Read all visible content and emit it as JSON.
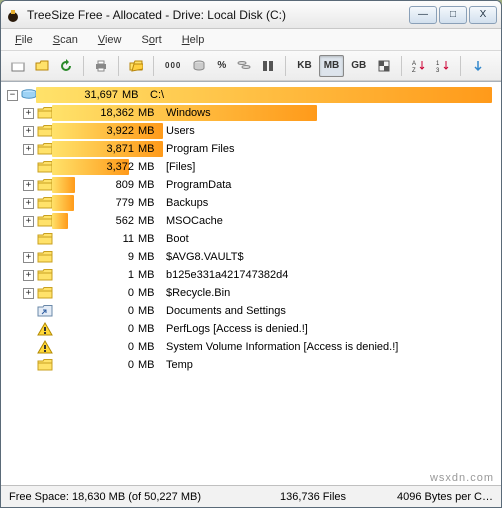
{
  "titlebar": {
    "title": "TreeSize Free - Allocated - Drive: Local Disk (C:)"
  },
  "menu": {
    "file": "File",
    "scan": "Scan",
    "view": "View",
    "sort": "Sort",
    "help": "Help"
  },
  "toolbar": {
    "kb": "KB",
    "mb": "MB",
    "gb": "GB"
  },
  "root": {
    "size": "31,697",
    "unit": "MB",
    "path": "C:\\"
  },
  "rows": [
    {
      "exp": true,
      "icon": "folder",
      "size": "18,362",
      "unit": "MB",
      "name": "Windows",
      "barpct": 62
    },
    {
      "exp": true,
      "icon": "folder",
      "size": "3,922",
      "unit": "MB",
      "name": "Users",
      "barpct": 26
    },
    {
      "exp": true,
      "icon": "folder",
      "size": "3,871",
      "unit": "MB",
      "name": "Program Files",
      "barpct": 26
    },
    {
      "exp": null,
      "icon": "folder",
      "size": "3,372",
      "unit": "MB",
      "name": "[Files]",
      "barpct": 18
    },
    {
      "exp": true,
      "icon": "folder",
      "size": "809",
      "unit": "MB",
      "name": "ProgramData",
      "barpct": 5.4
    },
    {
      "exp": true,
      "icon": "folder",
      "size": "779",
      "unit": "MB",
      "name": "Backups",
      "barpct": 5.2
    },
    {
      "exp": true,
      "icon": "folder",
      "size": "562",
      "unit": "MB",
      "name": "MSOCache",
      "barpct": 3.8
    },
    {
      "exp": null,
      "icon": "folder",
      "size": "11",
      "unit": "MB",
      "name": "Boot",
      "barpct": 0
    },
    {
      "exp": true,
      "icon": "folder",
      "size": "9",
      "unit": "MB",
      "name": "$AVG8.VAULT$",
      "barpct": 0
    },
    {
      "exp": true,
      "icon": "folder",
      "size": "1",
      "unit": "MB",
      "name": "b125e331a421747382d4",
      "barpct": 0
    },
    {
      "exp": true,
      "icon": "folder",
      "size": "0",
      "unit": "MB",
      "name": "$Recycle.Bin",
      "barpct": 0
    },
    {
      "exp": null,
      "icon": "link",
      "size": "0",
      "unit": "MB",
      "name": "Documents and Settings",
      "barpct": 0
    },
    {
      "exp": null,
      "icon": "warn",
      "size": "0",
      "unit": "MB",
      "name": "PerfLogs  [Access is denied.!]",
      "barpct": 0
    },
    {
      "exp": null,
      "icon": "warn",
      "size": "0",
      "unit": "MB",
      "name": "System Volume Information  [Access is denied.!]",
      "barpct": 0
    },
    {
      "exp": null,
      "icon": "folder",
      "size": "0",
      "unit": "MB",
      "name": "Temp",
      "barpct": 0
    }
  ],
  "status": {
    "free": "Free Space: 18,630 MB  (of 50,227 MB)",
    "files": "136,736  Files",
    "cluster": "4096 Bytes per C…"
  },
  "watermark": "wsxdn.com"
}
